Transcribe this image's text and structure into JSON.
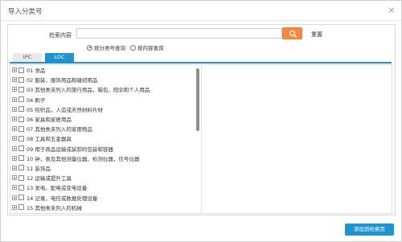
{
  "dialog": {
    "title": "导入分类号",
    "close_label": "×"
  },
  "search": {
    "label": "检索内容",
    "value": "",
    "placeholder": "",
    "reset_label": "重置"
  },
  "radios": [
    {
      "label": "按分类号查询",
      "selected": true
    },
    {
      "label": "按内容查询",
      "selected": false
    }
  ],
  "tabs": [
    {
      "label": "IPC",
      "active": false
    },
    {
      "label": "LOC",
      "active": true
    }
  ],
  "tree": {
    "items": [
      {
        "label": "01 食品"
      },
      {
        "label": "02 服装，服饰用品和缝纫用品"
      },
      {
        "label": "03 其他类未列入的旅行用品，箱包，阳伞和个人用品"
      },
      {
        "label": "04 刷子"
      },
      {
        "label": "05 纺织品，人造或天然材料片材"
      },
      {
        "label": "06 家具和家居用品"
      },
      {
        "label": "07 其他类未列入的家用物品"
      },
      {
        "label": "08 工具和五金器具"
      },
      {
        "label": "09 用于商品运输或装卸的包装和容器"
      },
      {
        "label": "10 钟，表及其他测量仪器，检测仪器，信号仪器"
      },
      {
        "label": "11 装饰品"
      },
      {
        "label": "12 运输或提升工具"
      },
      {
        "label": "13 发电，配电或变电设备"
      },
      {
        "label": "14 记录，电信或数据处理设备"
      },
      {
        "label": "15 其他类未列入的机械"
      }
    ],
    "scroll_position": 0.0
  },
  "footer": {
    "add_button_label": "添加到检索页"
  },
  "colors": {
    "accent": "#1f93d1",
    "search_button": "#f58a3c"
  },
  "icons": {
    "search": "search-icon",
    "close": "close-icon",
    "expander": "plus-box-icon"
  }
}
